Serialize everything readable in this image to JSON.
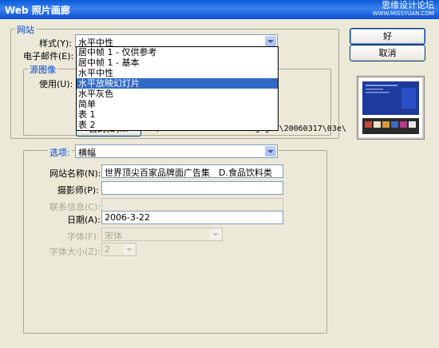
{
  "window": {
    "title": "Web 照片画廊",
    "watermark_line1": "思缘设计论坛",
    "watermark_line2": "WWW.MISSYUAN.COM"
  },
  "site": {
    "legend": "网站",
    "style_label": "样式(Y):",
    "style_value": "水平中性",
    "email_label": "电子邮件(E):"
  },
  "style_dropdown": {
    "options": [
      "居中帧 1 - 仅供参考",
      "居中帧 1 - 基本",
      "水平中性",
      "水平放映幻灯片",
      "水平灰色",
      "简单",
      "表 1",
      "表 2"
    ],
    "selected_index": 3
  },
  "source": {
    "legend": "源图像",
    "use_label": "使用(U):",
    "browse_label": "目的(D)...",
    "path": "C:\\Documents and Set...gogo8\\20060317\\03e\\"
  },
  "options": {
    "legend": "选项:",
    "select_value": "横幅",
    "fields": [
      {
        "label": "网站名称(N):",
        "value": "世界顶尖百家品牌面广告集__D.食品饮料类",
        "enabled": true
      },
      {
        "label": "摄影师(P):",
        "value": "",
        "enabled": true
      },
      {
        "label": "联系信息(C):",
        "value": "",
        "enabled": false
      },
      {
        "label": "日期(A):",
        "value": "2006-3-22",
        "enabled": true
      }
    ],
    "font_label": "字体(F):",
    "font_value": "宋体",
    "font_size_label": "字体大小(Z):",
    "font_size_value": "2"
  },
  "buttons": {
    "ok": "好",
    "cancel": "取消"
  },
  "colors": {
    "titlebar": "#0a5ad8",
    "selection": "#316ac5",
    "legend": "#0046d5",
    "dialog_bg": "#ece9d8"
  }
}
